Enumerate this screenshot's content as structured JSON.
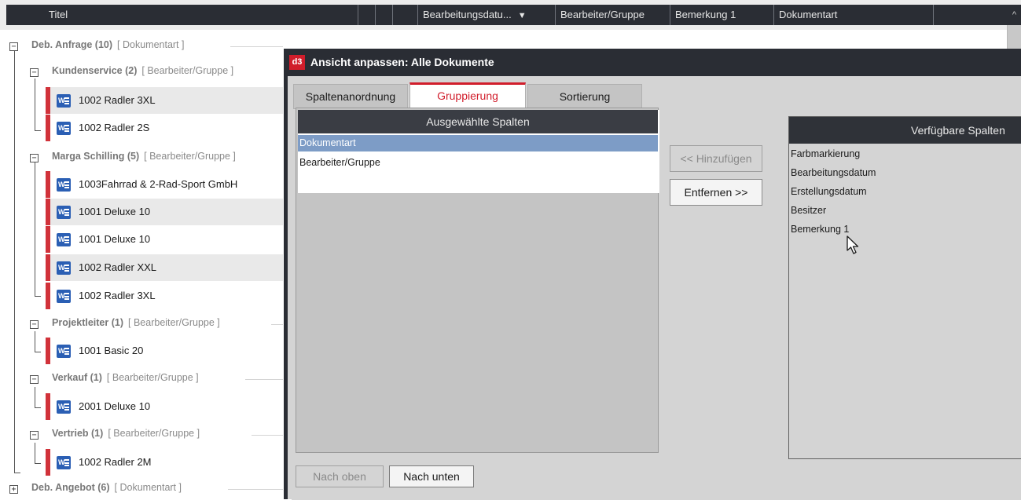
{
  "columns": {
    "title": "Titel",
    "edit_date": "Bearbeitungsdatu...",
    "editor_group": "Bearbeiter/Gruppe",
    "remark": "Bemerkung 1",
    "doc_type": "Dokumentart"
  },
  "icons": {
    "sort_desc": "▼",
    "scroll_up": "^",
    "collapse": "−",
    "expand": "+",
    "word_badge": "W",
    "app_logo": "d3"
  },
  "tree": {
    "top_group": {
      "name": "Deb. Anfrage (10)",
      "type": "[ Dokumentart ]"
    },
    "groups": [
      {
        "name": "Kundenservice (2)",
        "type": "[ Bearbeiter/Gruppe ]"
      },
      {
        "name": "Marga Schilling (5)",
        "type": "[ Bearbeiter/Gruppe ]"
      },
      {
        "name": "Projektleiter (1)",
        "type": "[ Bearbeiter/Gruppe ]"
      },
      {
        "name": "Verkauf (1)",
        "type": "[ Bearbeiter/Gruppe ]"
      },
      {
        "name": "Vertrieb (1)",
        "type": "[ Bearbeiter/Gruppe ]"
      }
    ],
    "docs": [
      "1002  Radler 3XL",
      "1002  Radler 2S",
      "1003Fahrrad & 2-Rad-Sport GmbH",
      "1001  Deluxe 10",
      "1001  Deluxe 10",
      "1002  Radler XXL",
      "1002  Radler 3XL",
      "1001  Basic 20",
      "2001  Deluxe 10",
      "1002  Radler 2M"
    ],
    "bottom_group": {
      "name": "Deb. Angebot (6)",
      "type": "[ Dokumentart ]"
    }
  },
  "dialog": {
    "title": "Ansicht anpassen: Alle Dokumente",
    "tabs": [
      "Spaltenanordnung",
      "Gruppierung",
      "Sortierung"
    ],
    "active_tab": "Gruppierung",
    "selected_header": "Ausgewählte Spalten",
    "selected_items": [
      "Dokumentart",
      "Bearbeiter/Gruppe"
    ],
    "available_header": "Verfügbare Spalten",
    "available_items": [
      "Farbmarkierung",
      "Bearbeitungsdatum",
      "Erstellungsdatum",
      "Besitzer",
      "Bemerkung 1"
    ],
    "add_label": "<< Hinzufügen",
    "remove_label": "Entfernen >>",
    "up_label": "Nach oben",
    "down_label": "Nach unten"
  },
  "colors": {
    "header_bg": "#2a2d34",
    "accent_red": "#d11d2b",
    "selection_blue": "#7d9cc6",
    "doc_marker": "#d1323a"
  }
}
